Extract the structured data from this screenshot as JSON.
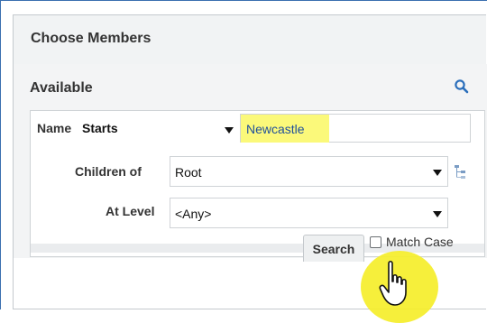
{
  "panel": {
    "title": "Choose Members"
  },
  "available": {
    "title": "Available",
    "search_icon": "magnifier-icon"
  },
  "form": {
    "name_label": "Name",
    "name_operator": "Starts",
    "name_value": "Newcastle",
    "children_of_label": "Children of",
    "children_of_value": "Root",
    "hierarchy_icon": "hierarchy-icon",
    "at_level_label": "At Level",
    "at_level_value": "<Any>",
    "search_button": "Search",
    "match_case_label": "Match Case",
    "match_case_checked": false
  },
  "colors": {
    "highlight": "#fbf97a",
    "cursor_glow": "#f5ee2a",
    "accent_blue": "#2a6ebb",
    "input_text": "#1f4f9c"
  },
  "cursor_icon": "pointer-hand-icon"
}
